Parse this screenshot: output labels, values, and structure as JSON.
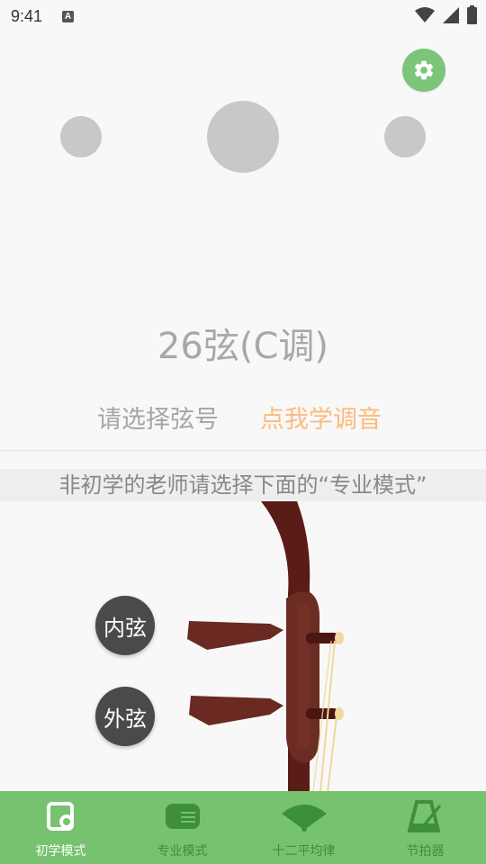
{
  "status_bar": {
    "time": "9:41",
    "notification_icon": "A"
  },
  "icons": {
    "settings": "gear-icon",
    "wifi": "wifi-icon",
    "signal": "signal-icon",
    "battery": "battery-icon"
  },
  "tuner": {
    "current_string": "26弦(C调)",
    "select_label": "请选择弦号",
    "learn_link": "点我学调音",
    "notice": "非初学的老师请选择下面的“专业模式”"
  },
  "erhu": {
    "inner_string": "内弦",
    "outer_string": "外弦"
  },
  "bottom_nav": [
    {
      "label": "初学模式",
      "icon": "beginner-icon",
      "active": true
    },
    {
      "label": "专业模式",
      "icon": "professional-icon",
      "active": false
    },
    {
      "label": "十二平均律",
      "icon": "fan-icon",
      "active": false
    },
    {
      "label": "节拍器",
      "icon": "metronome-icon",
      "active": false
    }
  ],
  "colors": {
    "accent_green": "#76c26e",
    "link_orange": "#fdbb7b",
    "erhu_wood": "#5e1f1a"
  }
}
